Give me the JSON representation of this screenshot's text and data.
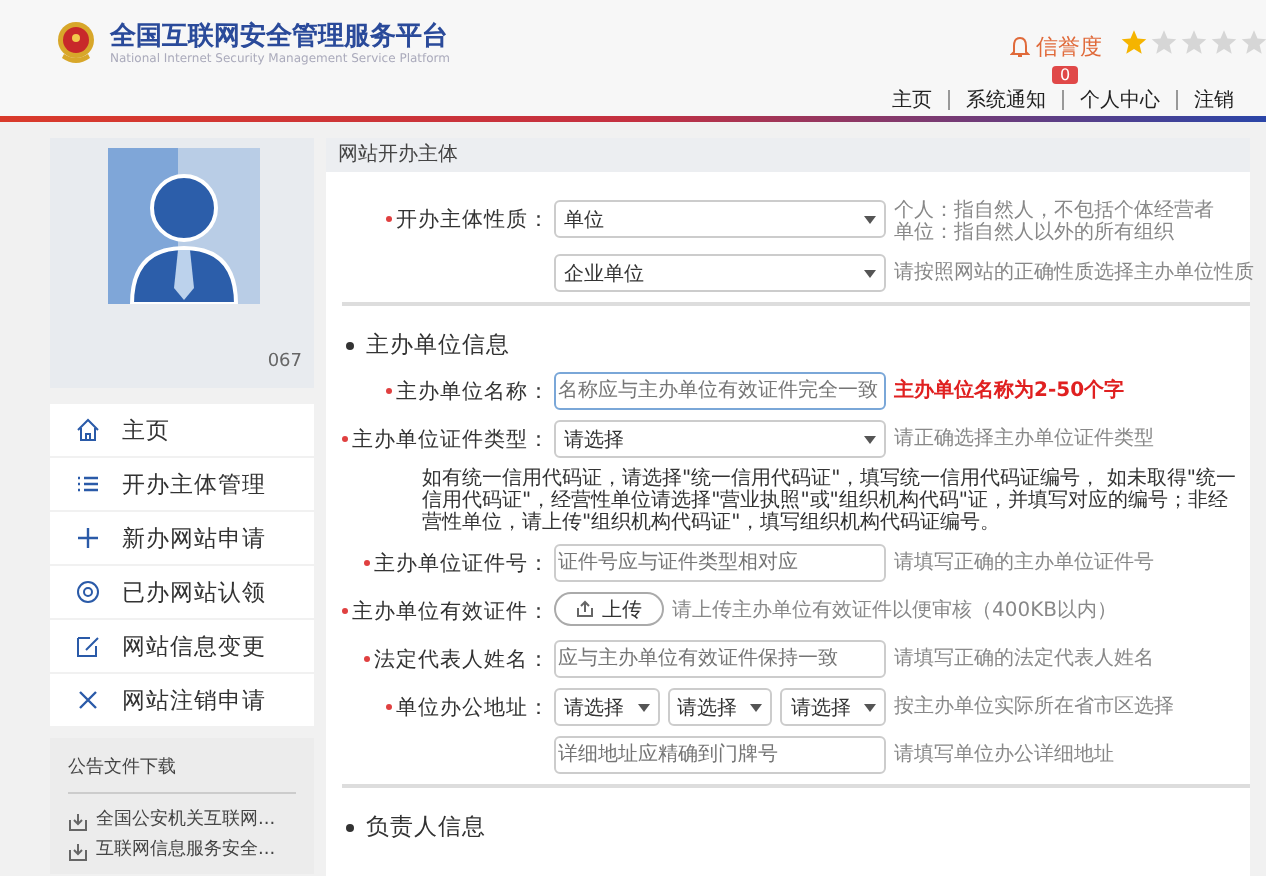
{
  "header": {
    "title": "全国互联网安全管理服务平台",
    "subtitle": "National Internet Security Management Service Platform",
    "credit_label": "信誉度",
    "stars": 1,
    "notification_badge": "0",
    "nav": [
      "主页",
      "系统通知",
      "个人中心",
      "注销"
    ]
  },
  "profile": {
    "user_id": "067"
  },
  "sidebar": {
    "items": [
      {
        "label": "主页",
        "kind": "home"
      },
      {
        "label": "开办主体管理",
        "kind": "list"
      },
      {
        "label": "新办网站申请",
        "kind": "plus"
      },
      {
        "label": "已办网站认领",
        "kind": "at"
      },
      {
        "label": "网站信息变更",
        "kind": "edit"
      },
      {
        "label": "网站注销申请",
        "kind": "close"
      }
    ],
    "downloads_title": "公告文件下载",
    "downloads": [
      "全国公安机关互联网...",
      "互联网信息服务安全..."
    ]
  },
  "panel": {
    "title": "网站开办主体",
    "sections": [
      {
        "rows": [
          {
            "kind": "select",
            "label": "开办主体性质：",
            "required": true,
            "value": "单位",
            "hint": [
              "个人：指自然人，不包括个体经营者",
              "单位：指自然人以外的所有组织"
            ],
            "error": false
          },
          {
            "kind": "select",
            "value": "企业单位",
            "hint": [
              "请按照网站的正确性质选择主办单位性质"
            ],
            "error": false
          }
        ]
      },
      {
        "heading": "主办单位信息",
        "rows": [
          {
            "kind": "input",
            "label": "主办单位名称：",
            "required": true,
            "placeholder": "名称应与主办单位有效证件完全一致",
            "focused": true,
            "hint": [
              "主办单位名称为2-50个字"
            ],
            "error": true
          },
          {
            "kind": "select",
            "label": "主办单位证件类型：",
            "required": true,
            "value": "请选择",
            "hint": [
              "请正确选择主办单位证件类型"
            ],
            "error": false
          },
          {
            "kind": "note",
            "text": "如有统一信用代码证，请选择\"统一信用代码证\"，填写统一信用代码证编号， 如未取得\"统一信用代码证\"，经营性单位请选择\"营业执照\"或\"组织机构代码\"证，并填写对应的编号；非经营性单位，请上传\"组织机构代码证\"，填写组织机构代码证编号。"
          },
          {
            "kind": "input",
            "label": "主办单位证件号：",
            "required": true,
            "placeholder": "证件号应与证件类型相对应",
            "focused": false,
            "hint": [
              "请填写正确的主办单位证件号"
            ],
            "error": false
          },
          {
            "kind": "upload",
            "label": "主办单位有效证件：",
            "required": true,
            "button": "上传",
            "hint": [
              "请上传主办单位有效证件以便审核（400KB以内）"
            ],
            "error": false
          },
          {
            "kind": "input",
            "label": "法定代表人姓名：",
            "required": true,
            "placeholder": "应与主办单位有效证件保持一致",
            "focused": false,
            "hint": [
              "请填写正确的法定代表人姓名"
            ],
            "error": false
          },
          {
            "kind": "select3",
            "label": "单位办公地址：",
            "required": true,
            "values": [
              "请选择",
              "请选择",
              "请选择"
            ],
            "hint": [
              "按主办单位实际所在省市区选择"
            ],
            "error": false
          },
          {
            "kind": "input",
            "placeholder": "详细地址应精确到门牌号",
            "focused": false,
            "hint": [
              "请填写单位办公详细地址"
            ],
            "error": false
          }
        ]
      },
      {
        "heading": "负责人信息"
      }
    ]
  }
}
